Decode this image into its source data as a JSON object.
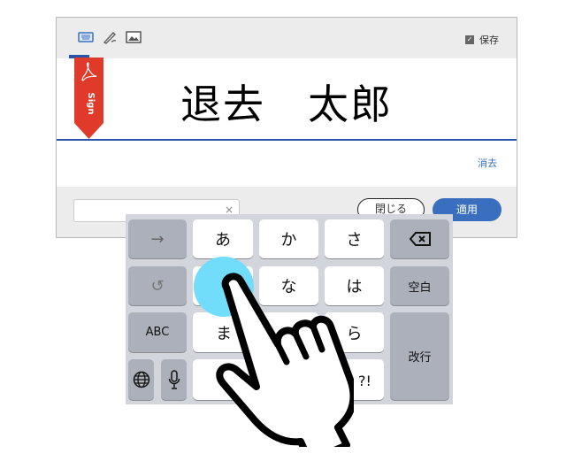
{
  "toolbar": {
    "tabs": [
      "keyboard-icon",
      "pen-signature-icon",
      "image-icon"
    ],
    "save_label": "保存",
    "save_checked": true
  },
  "signature": {
    "text": "退去　太郎",
    "ribbon_label": "Sign",
    "clear_label": "消去"
  },
  "footer": {
    "input_value": "",
    "clear_input": "×",
    "close_label": "閉じる",
    "apply_label": "適用"
  },
  "colors": {
    "accent": "#3a6fc0",
    "ribbon": "#e03a2a",
    "touch": "#72dcfb"
  },
  "keyboard": {
    "next": "→",
    "undo": "↺",
    "abc": "ABC",
    "globe": "globe-icon",
    "mic": "mic-icon",
    "a": "あ",
    "ka": "か",
    "sa": "さ",
    "delete": "delete-icon",
    "na": "な",
    "ha": "は",
    "space": "空白",
    "ma": "ま",
    "ra": "ら",
    "enter": "改行",
    "punct": "、。?!"
  }
}
